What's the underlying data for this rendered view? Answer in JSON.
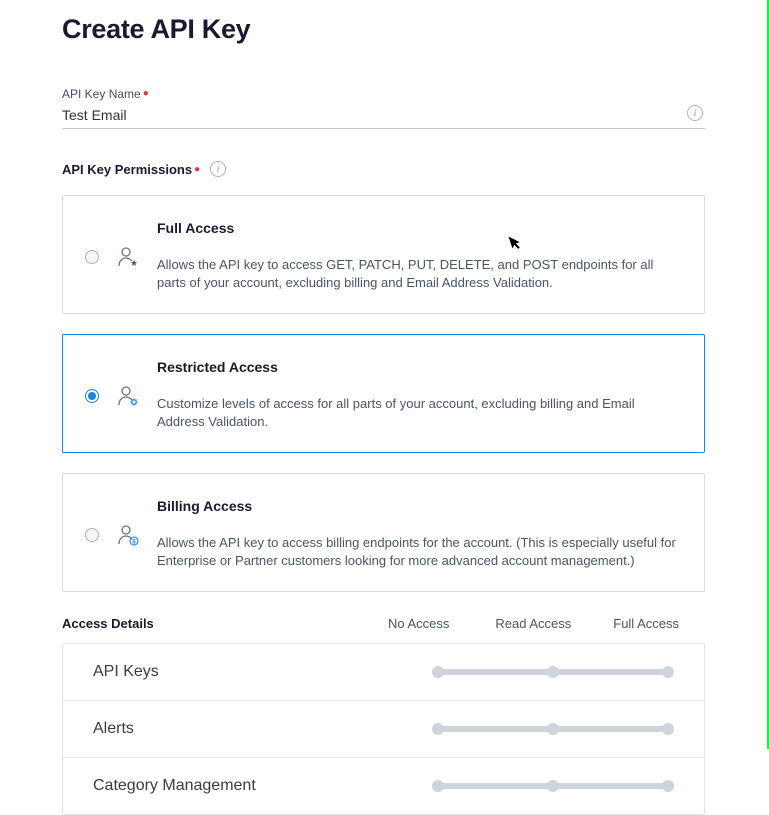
{
  "page_title": "Create API Key",
  "api_key_name": {
    "label": "API Key Name",
    "value": "Test Email"
  },
  "permissions_label": "API Key Permissions",
  "permissions": [
    {
      "id": "full",
      "title": "Full Access",
      "description": "Allows the API key to access GET, PATCH, PUT, DELETE, and POST endpoints for all parts of your account, excluding billing and Email Address Validation.",
      "selected": false
    },
    {
      "id": "restricted",
      "title": "Restricted Access",
      "description": "Customize levels of access for all parts of your account, excluding billing and Email Address Validation.",
      "selected": true
    },
    {
      "id": "billing",
      "title": "Billing Access",
      "description": "Allows the API key to access billing endpoints for the account. (This is especially useful for Enterprise or Partner customers looking for more advanced account management.)",
      "selected": false
    }
  ],
  "access_details": {
    "title": "Access Details",
    "columns": [
      "No Access",
      "Read Access",
      "Full Access"
    ],
    "rows": [
      {
        "label": "API Keys",
        "level": 0
      },
      {
        "label": "Alerts",
        "level": 0
      },
      {
        "label": "Category Management",
        "level": 0
      }
    ]
  }
}
